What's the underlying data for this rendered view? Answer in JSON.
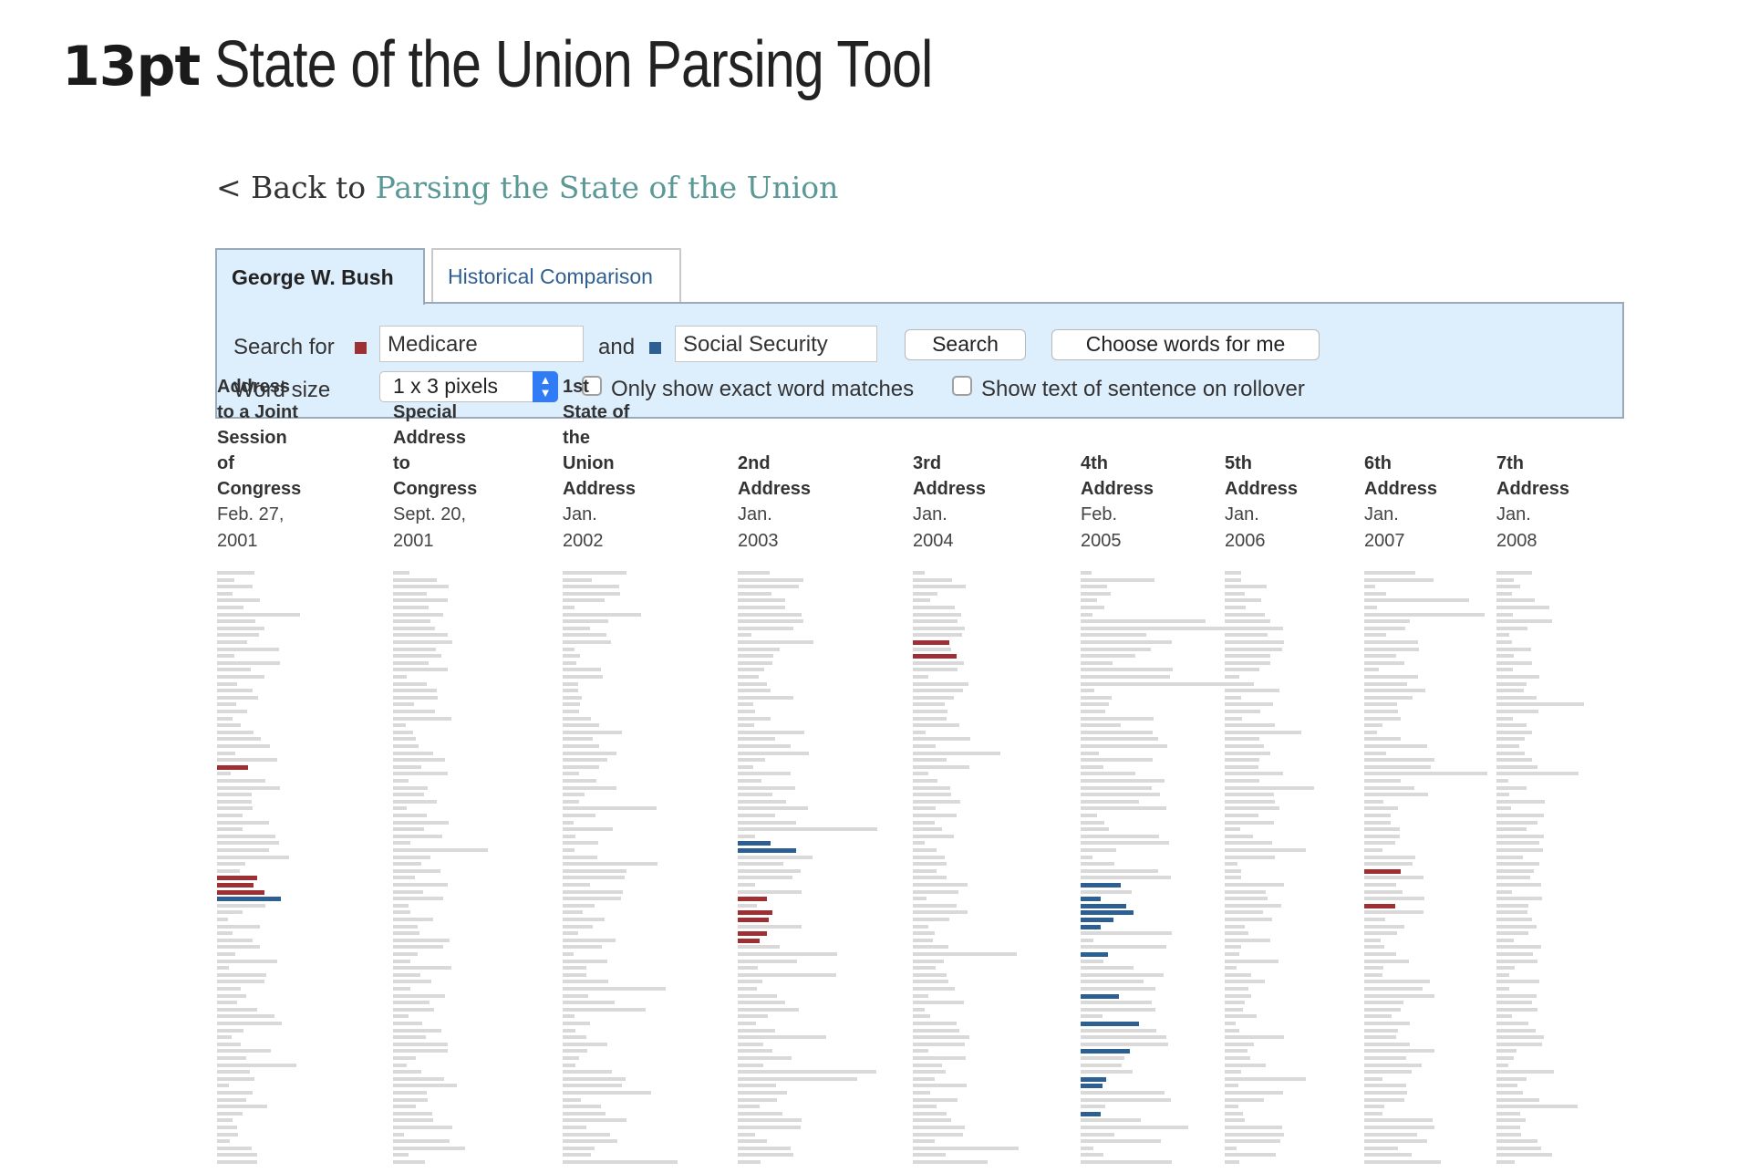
{
  "header": {
    "brand": "13pt",
    "title": "State of the Union Parsing Tool"
  },
  "back": {
    "prefix": "< Back to",
    "link_text": "Parsing the State of the Union"
  },
  "tabs": [
    {
      "label": "George W. Bush",
      "active": true
    },
    {
      "label": "Historical Comparison",
      "active": false
    }
  ],
  "controls": {
    "search_for_label": "Search for",
    "term1": "Medicare",
    "and_label": "and",
    "term2": "Social Security",
    "search_button": "Search",
    "choose_button": "Choose words for me",
    "word_size_label": "Word size",
    "word_size_value": "1 x 3 pixels",
    "exact_label": "Only show exact word matches",
    "rollover_label": "Show text of sentence on rollover",
    "exact_checked": false,
    "rollover_checked": false
  },
  "colors": {
    "term1": "#9e2f33",
    "term2": "#2d5f92",
    "neutral": "#d9d9d9",
    "link": "#5a9995",
    "panel_bg": "#ddeefd"
  },
  "speeches": [
    {
      "name_lines": [
        "Address to a Joint",
        "Session of",
        "Congress"
      ],
      "date": "Feb. 27, 2001"
    },
    {
      "name_lines": [
        "Special Address",
        "to Congress"
      ],
      "date": "Sept. 20, 2001"
    },
    {
      "name_lines": [
        "1st State of the",
        "Union Address"
      ],
      "date": "Jan. 2002"
    },
    {
      "name_lines": [
        "2nd Address"
      ],
      "date": "Jan. 2003"
    },
    {
      "name_lines": [
        "3rd Address"
      ],
      "date": "Jan. 2004"
    },
    {
      "name_lines": [
        "4th Address"
      ],
      "date": "Feb. 2005"
    },
    {
      "name_lines": [
        "5th Address"
      ],
      "date": "Jan. 2006"
    },
    {
      "name_lines": [
        "6th Address"
      ],
      "date": "Jan. 2007"
    },
    {
      "name_lines": [
        "7th Address"
      ],
      "date": "Jan. 2008"
    }
  ]
}
